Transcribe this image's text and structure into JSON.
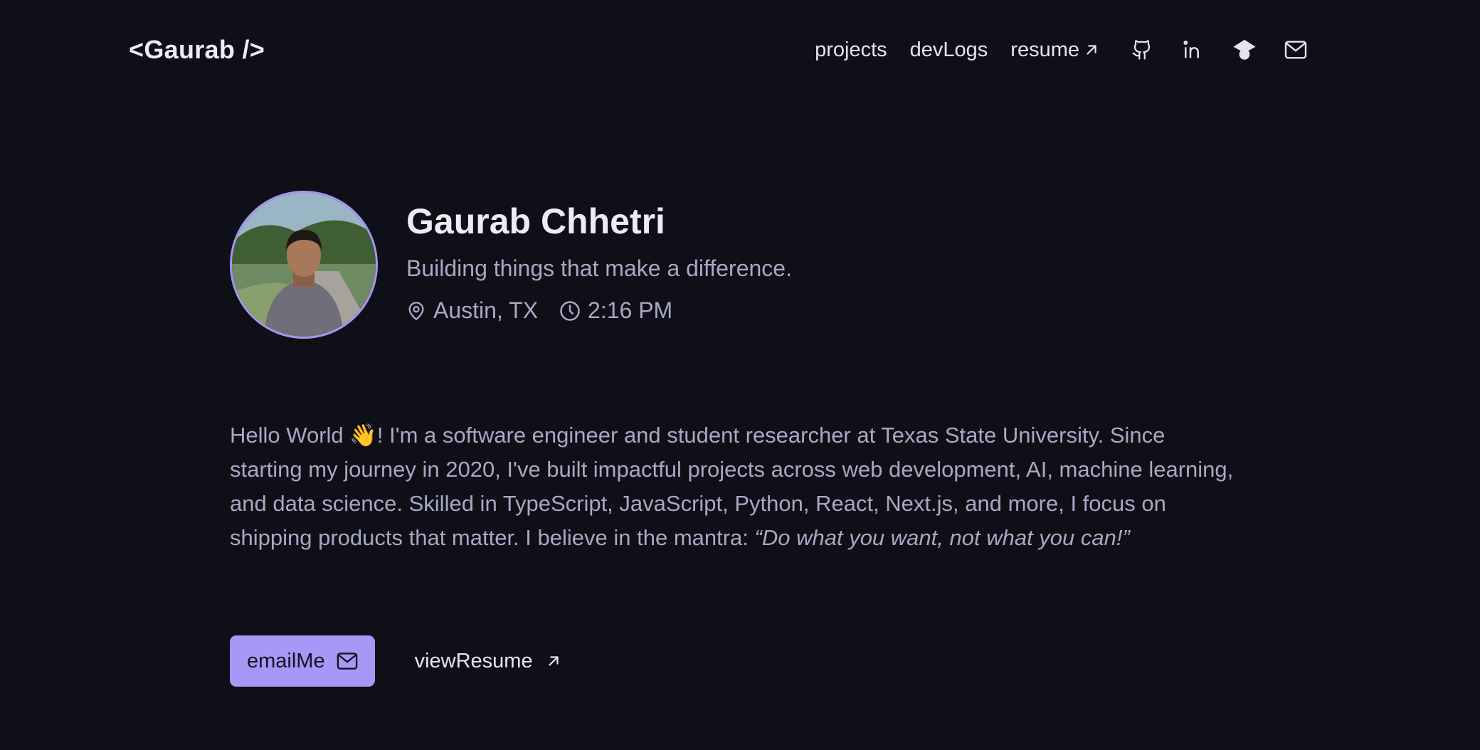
{
  "header": {
    "logo": "<Gaurab />",
    "nav": {
      "projects": "projects",
      "devlogs": "devLogs",
      "resume": "resume"
    },
    "icons": [
      "github-icon",
      "linkedin-icon",
      "graduation-cap-icon",
      "mail-icon"
    ]
  },
  "profile": {
    "name": "Gaurab Chhetri",
    "tagline": "Building things that make a difference.",
    "location": "Austin, TX",
    "time": "2:16 PM"
  },
  "bio": {
    "text": "Hello World 👋! I'm a software engineer and student researcher at Texas State University. Since starting my journey in 2020, I've built impactful projects across web development, AI, machine learning, and data science. Skilled in TypeScript, JavaScript, Python, React, Next.js, and more, I focus on shipping products that matter. I believe in the mantra: ",
    "quote": "“Do what you want, not what you can!”"
  },
  "actions": {
    "email_label": "emailMe",
    "resume_label": "viewResume"
  },
  "colors": {
    "background": "#0f0f18",
    "accent": "#a897f6",
    "text": "#e6e6ee",
    "muted": "#a9a8c4"
  }
}
